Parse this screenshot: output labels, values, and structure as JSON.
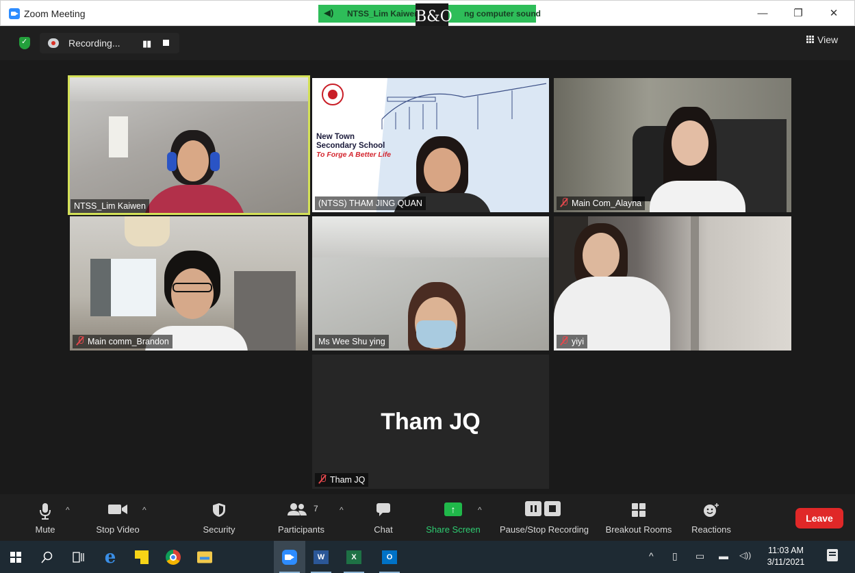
{
  "window": {
    "title": "Zoom Meeting",
    "minimize": "—",
    "restore": "❐",
    "close": "✕"
  },
  "speaking_banner": {
    "name": "NTSS_Lim Kaiwen",
    "text": "ng computer sound",
    "overlay_logo": "B&O"
  },
  "recording": {
    "label": "Recording...",
    "pause": "▮▮"
  },
  "view_button": "View",
  "participants": [
    {
      "label": "NTSS_Lim Kaiwen",
      "muted": false,
      "active_speaker": true
    },
    {
      "label": "(NTSS) THAM JING QUAN",
      "muted": false,
      "active_speaker": false
    },
    {
      "label": "Main Com_Alayna",
      "muted": true,
      "active_speaker": false
    },
    {
      "label": "Main comm_Brandon",
      "muted": true,
      "active_speaker": false
    },
    {
      "label": "Ms Wee Shu ying",
      "muted": false,
      "active_speaker": false
    },
    {
      "label": "yiyi",
      "muted": true,
      "active_speaker": false
    },
    {
      "label": "Tham JQ",
      "muted": true,
      "active_speaker": false,
      "name_card": "Tham JQ"
    }
  ],
  "school_background": {
    "line1": "New Town",
    "line2": "Secondary School",
    "motto": "To Forge A Better Life"
  },
  "toolbar": {
    "mute": "Mute",
    "stop_video": "Stop Video",
    "security": "Security",
    "participants": "Participants",
    "participants_count": "7",
    "chat": "Chat",
    "share_screen": "Share Screen",
    "pause_stop_recording": "Pause/Stop Recording",
    "breakout_rooms": "Breakout Rooms",
    "reactions": "Reactions",
    "leave": "Leave"
  },
  "taskbar": {
    "time": "11:03 AM",
    "date": "3/11/2021",
    "word_letter": "W",
    "excel_letter": "X",
    "outlook_letter": "O"
  },
  "colors": {
    "active_speaker_border": "#d4e157",
    "share_green": "#20b84a",
    "leave_red": "#e02828",
    "muted_red": "#e5484d",
    "zoom_blue": "#2d8cff"
  }
}
